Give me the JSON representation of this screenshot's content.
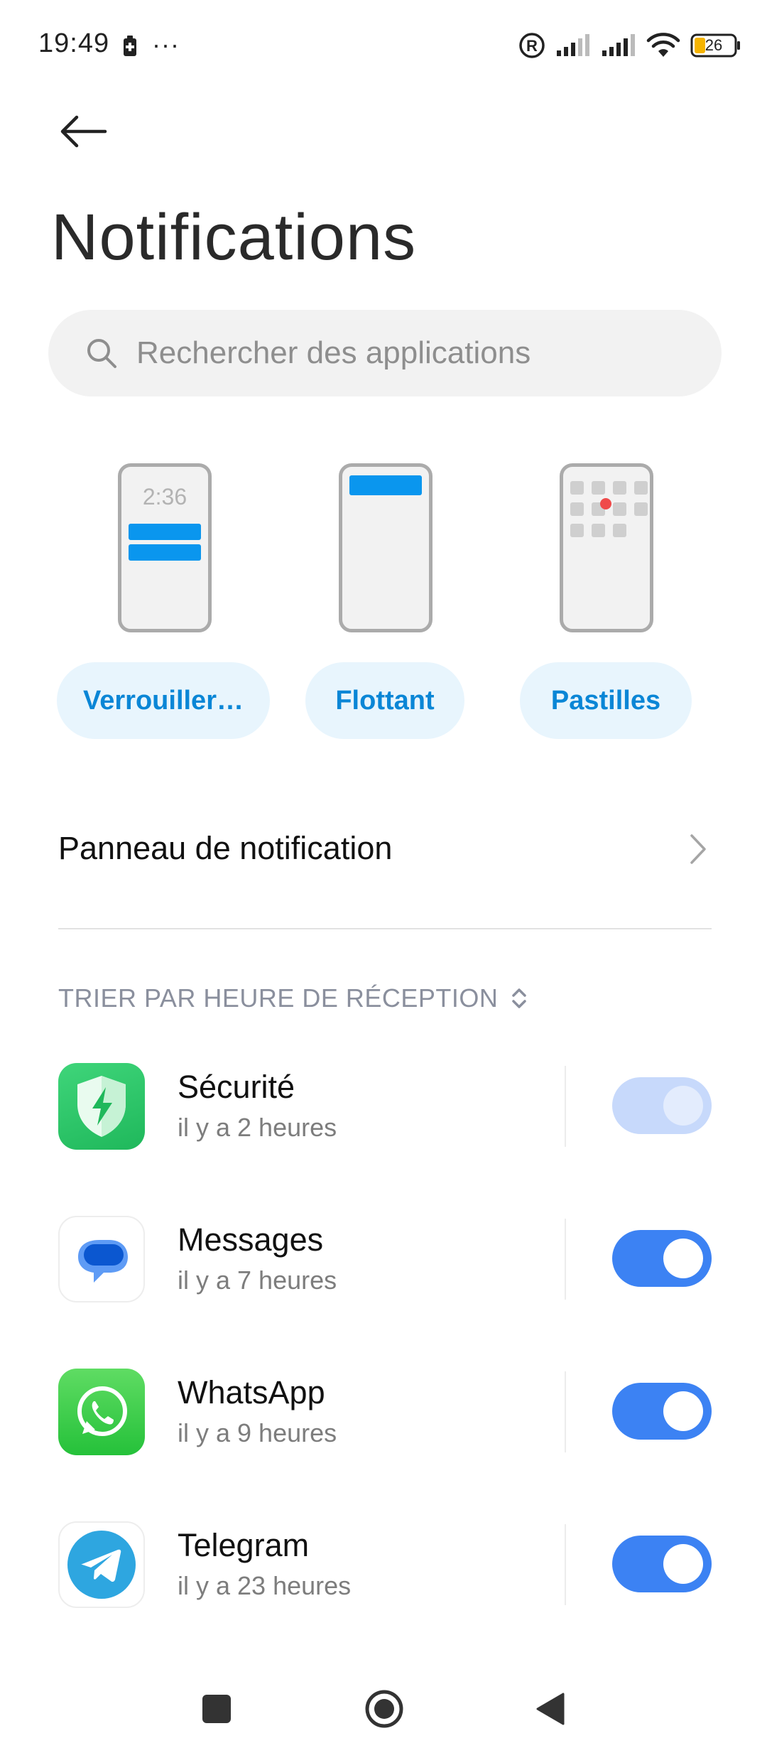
{
  "status_bar": {
    "time": "19:49",
    "more": "···",
    "battery_level": "26",
    "accent_battery": "#f5b400"
  },
  "header": {
    "title": "Notifications"
  },
  "search": {
    "placeholder": "Rechercher des applications"
  },
  "styles": {
    "lock_screen_time": "2:36",
    "options": [
      {
        "label": "Verrouiller…"
      },
      {
        "label": "Flottant"
      },
      {
        "label": "Pastilles"
      }
    ]
  },
  "panel": {
    "label": "Panneau de notification"
  },
  "sort": {
    "label": "TRIER PAR HEURE DE RÉCEPTION"
  },
  "apps": [
    {
      "name": "Sécurité",
      "time": "il y a 2 heures",
      "icon": "security-shield-icon",
      "enabled": true,
      "toggle_disabled": true
    },
    {
      "name": "Messages",
      "time": "il y a 7 heures",
      "icon": "messages-bubble-icon",
      "enabled": true,
      "toggle_disabled": false
    },
    {
      "name": "WhatsApp",
      "time": "il y a 9 heures",
      "icon": "whatsapp-icon",
      "enabled": true,
      "toggle_disabled": false
    },
    {
      "name": "Telegram",
      "time": "il y a 23 heures",
      "icon": "telegram-icon",
      "enabled": true,
      "toggle_disabled": false
    }
  ],
  "colors": {
    "accent_blue": "#3c82f3",
    "style_button_bg": "#e8f5fd",
    "style_button_text": "#0a86d6"
  }
}
